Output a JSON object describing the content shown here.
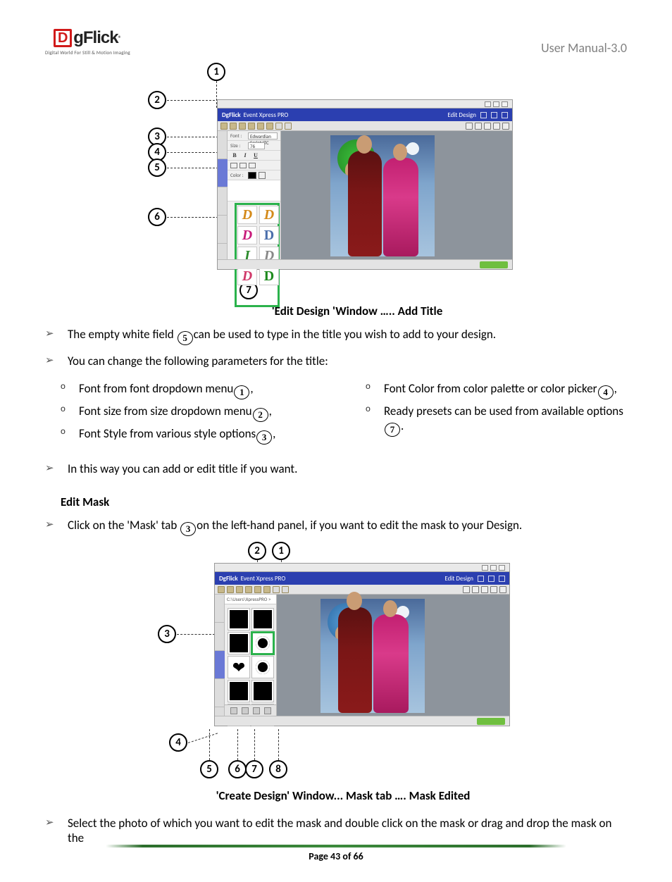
{
  "header": {
    "right": "User Manual-3.0"
  },
  "logo": {
    "d": "D",
    "text": "gFlick",
    "reg": "®",
    "tag": "Digital World For Still & Motion Imaging"
  },
  "fig1": {
    "caption": "'Edit Design 'Window ….. Add Title",
    "callouts": {
      "c1": "1",
      "c2": "2",
      "c3": "3",
      "c4": "4",
      "c5": "5",
      "c6": "6",
      "c7": "7"
    },
    "brandbar_left": "DgFlick",
    "brandbar_prod": "Event Xpress PRO",
    "brandbar_right": "Edit Design",
    "panel": {
      "font_lbl": "Font :",
      "font_val": "Edwardian Script ITC",
      "size_lbl": "Size :",
      "size_val": "76",
      "style_b": "B",
      "style_i": "I",
      "style_u": "U",
      "color_lbl": "Color :"
    },
    "presets": {
      "d1": "D",
      "d2": "D",
      "d3": "D",
      "d4": "D",
      "d5": "I",
      "d6": "D",
      "d7": "D",
      "d8": "D"
    }
  },
  "bullets": {
    "a1_pre": "The empty white field ",
    "a1_post": "can be used to type in the title you wish to add to your design.",
    "a2": "You can change the following parameters for the title:",
    "l1": "Font from font dropdown menu",
    "l2": "Font size from size dropdown menu",
    "l3": "Font Style from various style options",
    "r1": "Font Color from color palette or color picker",
    "r2": "Ready presets can be used from available options",
    "a3": "In this way you can add or edit title if you want.",
    "sec": "Edit Mask",
    "m1_pre": "Click on the 'Mask' tab ",
    "m1_post": "on the left-hand panel, if you want to edit the mask to your Design.",
    "m2": "Select the photo of which you want to edit the mask and double click on the mask or drag and drop the mask on the"
  },
  "fig2": {
    "caption": "'Create Design' Window... Mask tab …. Mask Edited",
    "callouts": {
      "c1": "1",
      "c2": "2",
      "c3": "3",
      "c4": "4",
      "c5": "5",
      "c6": "6",
      "c7": "7",
      "c8": "8"
    },
    "brandbar_left": "DgFlick",
    "brandbar_prod": "Event Xpress PRO",
    "brandbar_right": "Edit Design",
    "path": "C:\\Users\\XpressPRO  >"
  },
  "footer": {
    "page": "Page 43 of 66"
  }
}
